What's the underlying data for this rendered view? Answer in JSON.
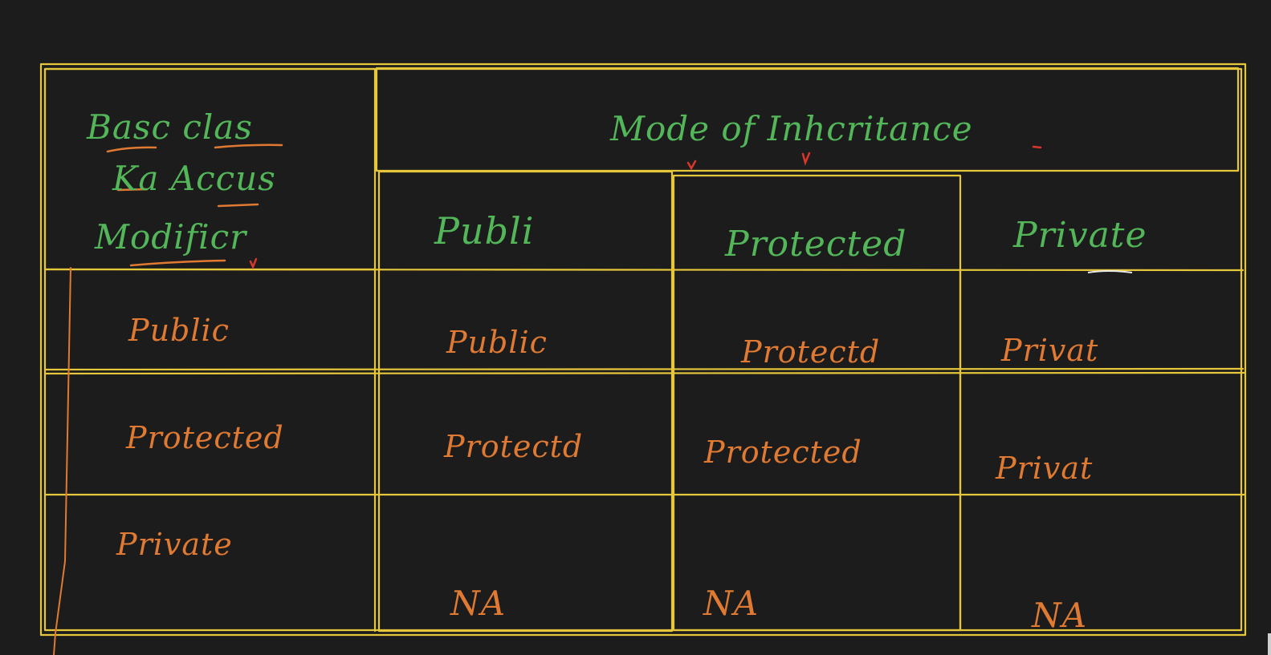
{
  "colors": {
    "background": "#1c1c1c",
    "grid_line": "#e6c63a",
    "heading_ink": "#53b75a",
    "body_ink": "#e07a33",
    "tick_ink": "#d9372a"
  },
  "table": {
    "corner_header": [
      "Basc clas",
      "Ka Accus",
      "Modificr"
    ],
    "mode_header": "Mode of Inhcritance",
    "mode_columns": [
      "Publi",
      "Protected",
      "Private"
    ],
    "rows": [
      {
        "label": "Public",
        "cells": [
          "Public",
          "Protectd",
          "Privat"
        ]
      },
      {
        "label": "Protected",
        "cells": [
          "Protectd",
          "Protected",
          "Privat"
        ]
      },
      {
        "label": "Private",
        "cells": [
          "NA",
          "NA",
          "NA"
        ]
      }
    ]
  }
}
